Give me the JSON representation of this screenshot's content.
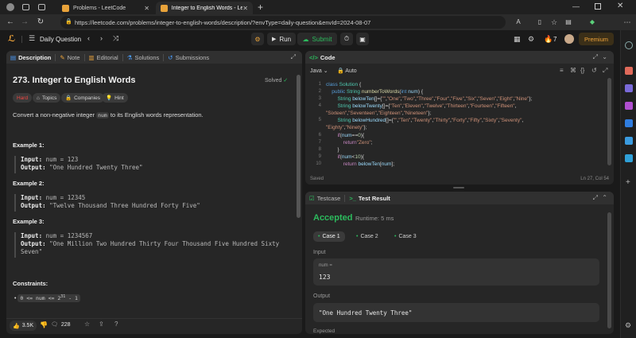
{
  "browser": {
    "tabs": [
      {
        "title": "Problems - LeetCode",
        "active": false
      },
      {
        "title": "Integer to English Words - LeetC",
        "active": true
      }
    ],
    "url": "https://leetcode.com/problems/integer-to-english-words/description/?envType=daily-question&envId=2024-08-07"
  },
  "topbar": {
    "daily_label": "Daily Question",
    "run_label": "Run",
    "submit_label": "Submit",
    "streak": "7",
    "premium_label": "Premium"
  },
  "description": {
    "tabs": [
      "Description",
      "Note",
      "Editorial",
      "Solutions",
      "Submissions"
    ],
    "title": "273. Integer to English Words",
    "solved_label": "Solved",
    "chips": [
      "Hard",
      "Topics",
      "Companies",
      "Hint"
    ],
    "statement_pre": "Convert a non-negative integer",
    "statement_code": "num",
    "statement_post": "to its English words representation.",
    "examples": [
      {
        "heading": "Example 1:",
        "input_label": "Input:",
        "input_value": "num = 123",
        "output_label": "Output:",
        "output_value": "\"One Hundred Twenty Three\""
      },
      {
        "heading": "Example 2:",
        "input_label": "Input:",
        "input_value": "num = 12345",
        "output_label": "Output:",
        "output_value": "\"Twelve Thousand Three Hundred Forty Five\""
      },
      {
        "heading": "Example 3:",
        "input_label": "Input:",
        "input_value": "num = 1234567",
        "output_label": "Output:",
        "output_value_1": "\"One Million Two Hundred Thirty Four Thousand Five Hundred Sixty",
        "output_value_2": "Seven\""
      }
    ],
    "constraints_heading": "Constraints:",
    "constraint_pre": "0 <= num <= 2",
    "constraint_sup": "31",
    "constraint_post": " - 1",
    "likes": "3.5K",
    "comments": "228"
  },
  "code": {
    "header": "Code",
    "language": "Java",
    "auto_label": "Auto",
    "saved_label": "Saved",
    "cursor_label": "Ln 27, Col 54",
    "line_numbers": [
      "1",
      "2",
      "3",
      "",
      "4",
      "",
      "5",
      "6",
      "7",
      "8",
      "9",
      "10"
    ]
  },
  "result": {
    "testcase_tab": "Testcase",
    "result_tab": "Test Result",
    "status": "Accepted",
    "runtime": "Runtime: 5 ms",
    "cases": [
      "Case 1",
      "Case 2",
      "Case 3"
    ],
    "input_label": "Input",
    "input_var": "num =",
    "input_value": "123",
    "output_label": "Output",
    "output_value": "\"One Hundred Twenty Three\"",
    "expected_label": "Expected"
  }
}
